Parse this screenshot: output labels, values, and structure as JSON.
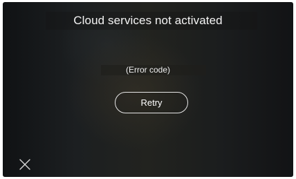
{
  "dialog": {
    "title": "Cloud services not activated",
    "error_message": "(Error code)",
    "retry_label": "Retry"
  },
  "icons": {
    "close": "close-icon"
  },
  "colors": {
    "background": "#1c1e20",
    "text": "#ffffff",
    "button_border": "#e8e8e8"
  }
}
